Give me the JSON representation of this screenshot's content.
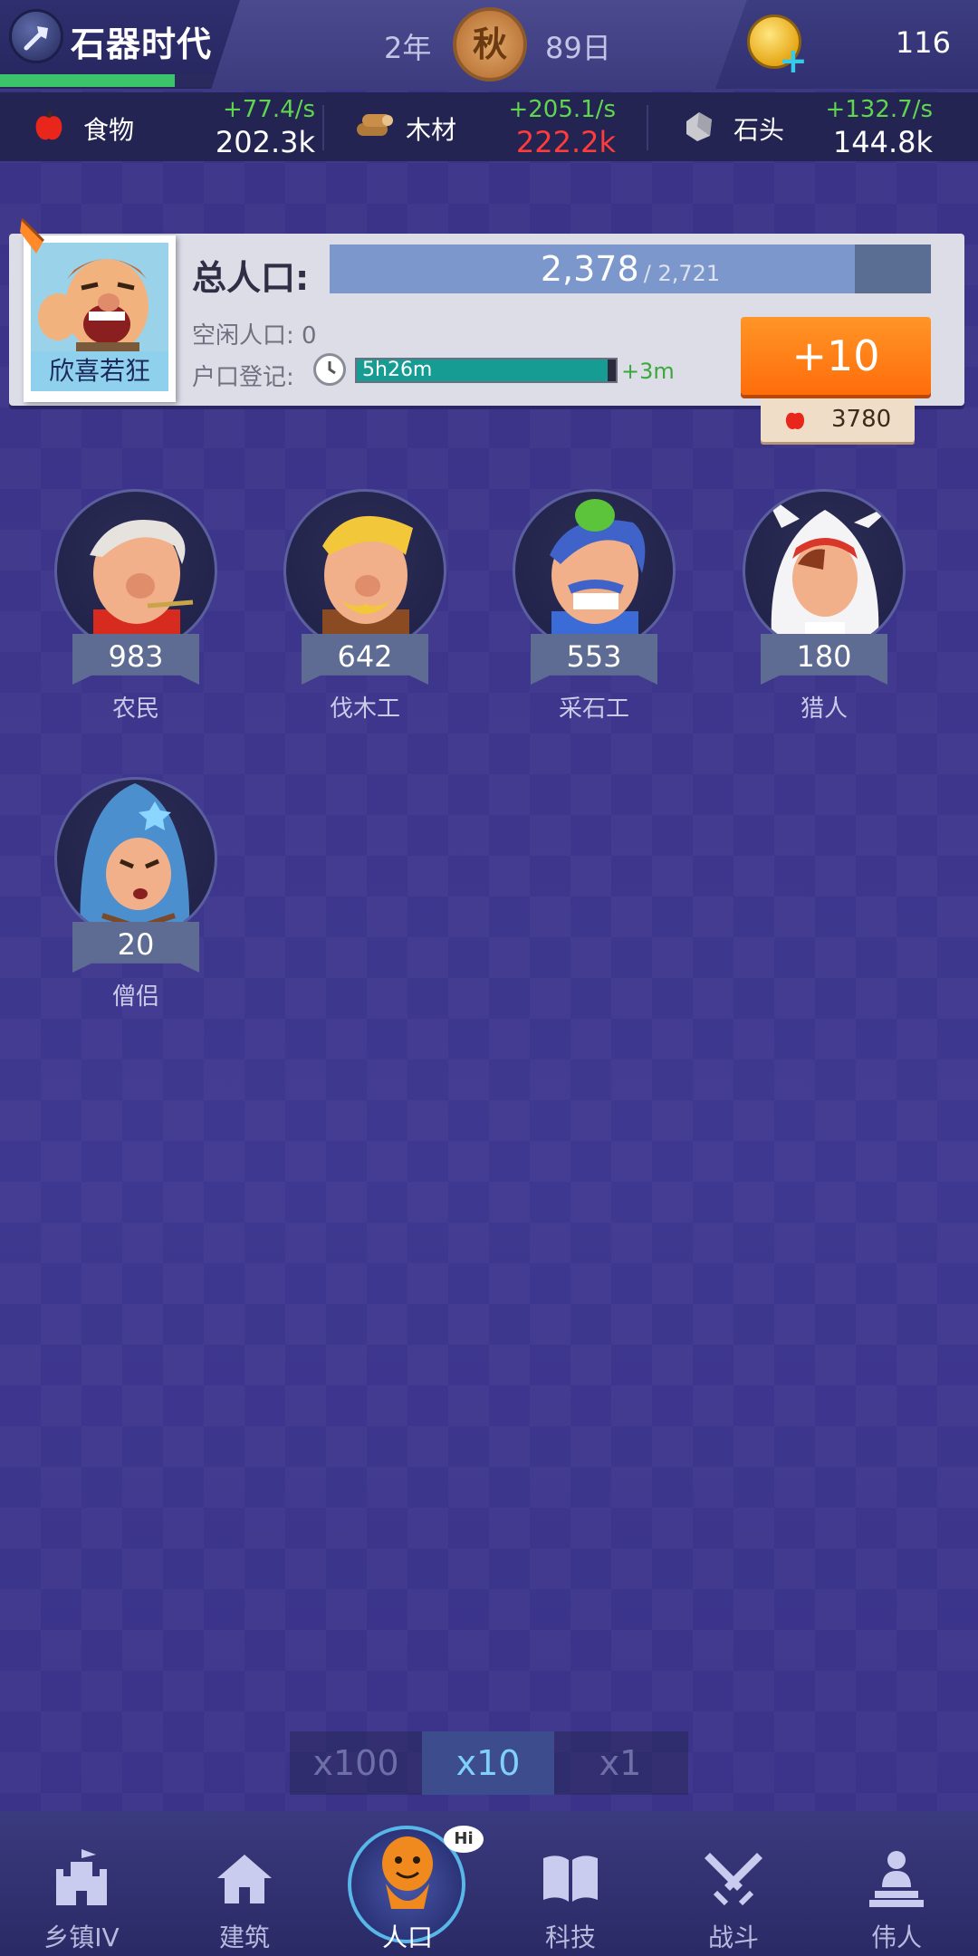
{
  "header": {
    "era_title": "石器时代",
    "era_progress": 0.73,
    "year": "2年",
    "season": "秋",
    "day": "89日",
    "gems": "116"
  },
  "resources": [
    {
      "name": "食物",
      "rate": "+77.4/s",
      "amount": "202.3k",
      "icon": "apple-icon",
      "amount_color": "#ffffff"
    },
    {
      "name": "木材",
      "rate": "+205.1/s",
      "amount": "222.2k",
      "icon": "wood-icon",
      "amount_color": "#ff3b3b"
    },
    {
      "name": "石头",
      "rate": "+132.7/s",
      "amount": "144.8k",
      "icon": "stone-icon",
      "amount_color": "#ffffff"
    }
  ],
  "population": {
    "mood_label": "欣喜若狂",
    "title": "总人口:",
    "current": "2,378",
    "max": "/ 2,721",
    "fill": 0.874,
    "idle": "空闲人口: 0",
    "registration_label": "户口登记:",
    "registration_time": "5h26m",
    "registration_fill": 0.97,
    "registration_bonus": "+3m",
    "add_button": "+10",
    "cost": "3780"
  },
  "workers": [
    {
      "name": "农民",
      "count": "983"
    },
    {
      "name": "伐木工",
      "count": "642"
    },
    {
      "name": "采石工",
      "count": "553"
    },
    {
      "name": "猎人",
      "count": "180"
    },
    {
      "name": "僧侣",
      "count": "20"
    }
  ],
  "multipliers": [
    "x100",
    "x10",
    "x1"
  ],
  "multiplier_active": "x10",
  "nav": [
    {
      "label": "乡镇IV",
      "icon": "castle-icon"
    },
    {
      "label": "建筑",
      "icon": "house-icon"
    },
    {
      "label": "人口",
      "icon": "population-icon"
    },
    {
      "label": "科技",
      "icon": "book-icon"
    },
    {
      "label": "战斗",
      "icon": "swords-icon"
    },
    {
      "label": "伟人",
      "icon": "statue-icon"
    }
  ],
  "nav_active": "人口",
  "nav_badge": "Hi"
}
